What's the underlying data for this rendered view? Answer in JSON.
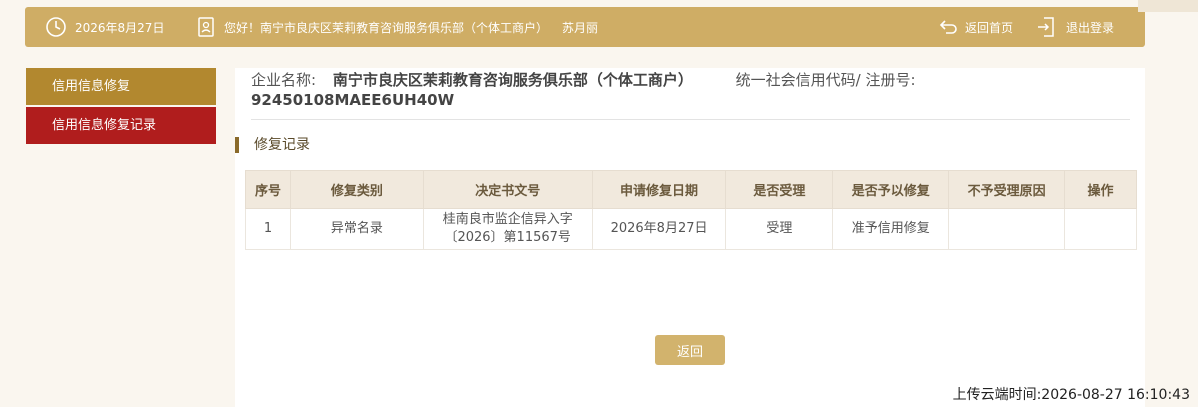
{
  "header": {
    "date": "2026年8月27日",
    "greeting": "您好！南宁市良庆区茉莉教育咨询服务俱乐部（个体工商户）",
    "user": "苏月丽",
    "home_label": "返回首页",
    "logout_label": "退出登录"
  },
  "sidebar": {
    "items": [
      {
        "label": "信用信息修复"
      },
      {
        "label": "信用信息修复记录"
      }
    ]
  },
  "company": {
    "name_label": "企业名称:",
    "name": "南宁市良庆区茉莉教育咨询服务俱乐部（个体工商户）",
    "code_label": "统一社会信用代码/ 注册号:",
    "code": "92450108MAEE6UH40W"
  },
  "section_title": "修复记录",
  "table": {
    "headers": [
      "序号",
      "修复类别",
      "决定书文号",
      "申请修复日期",
      "是否受理",
      "是否予以修复",
      "不予受理原因",
      "操作"
    ],
    "rows": [
      [
        "1",
        "异常名录",
        "桂南良市监企信异入字〔2026〕第11567号",
        "2026年8月27日",
        "受理",
        "准予信用修复",
        "",
        ""
      ]
    ]
  },
  "back_label": "返回",
  "upload_time": "上传云端时间:2026-08-27 16:10:43"
}
